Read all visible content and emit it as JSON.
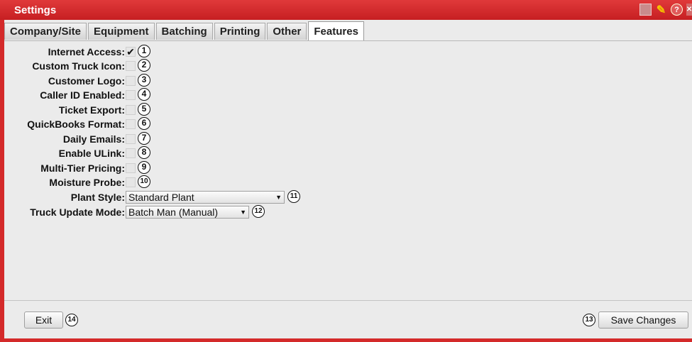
{
  "window": {
    "title": "Settings"
  },
  "titlebar_icons": [
    "document-icon",
    "pin-icon",
    "help-icon",
    "close-icon"
  ],
  "tabs": [
    {
      "label": "Company/Site",
      "active": false
    },
    {
      "label": "Equipment",
      "active": false
    },
    {
      "label": "Batching",
      "active": false
    },
    {
      "label": "Printing",
      "active": false
    },
    {
      "label": "Other",
      "active": false
    },
    {
      "label": "Features",
      "active": true
    }
  ],
  "features": [
    {
      "label": "Internet Access:",
      "checked": true,
      "marker": "1"
    },
    {
      "label": "Custom Truck Icon:",
      "checked": false,
      "marker": "2"
    },
    {
      "label": "Customer Logo:",
      "checked": false,
      "marker": "3"
    },
    {
      "label": "Caller ID Enabled:",
      "checked": false,
      "marker": "4"
    },
    {
      "label": "Ticket Export:",
      "checked": false,
      "marker": "5"
    },
    {
      "label": "QuickBooks Format:",
      "checked": false,
      "marker": "6"
    },
    {
      "label": "Daily Emails:",
      "checked": false,
      "marker": "7"
    },
    {
      "label": "Enable ULink:",
      "checked": false,
      "marker": "8"
    },
    {
      "label": "Multi-Tier Pricing:",
      "checked": false,
      "marker": "9"
    },
    {
      "label": "Moisture Probe:",
      "checked": false,
      "marker": "10"
    }
  ],
  "plant_style": {
    "label": "Plant Style:",
    "value": "Standard Plant",
    "marker": "11"
  },
  "truck_update_mode": {
    "label": "Truck Update Mode:",
    "value": "Batch Man (Manual)",
    "marker": "12"
  },
  "footer": {
    "exit_label": "Exit",
    "exit_marker": "14",
    "save_label": "Save Changes",
    "save_marker": "13"
  },
  "check_glyph": "✔",
  "colors": {
    "titlebar": "#d42a2a",
    "panel": "#ebebeb"
  }
}
